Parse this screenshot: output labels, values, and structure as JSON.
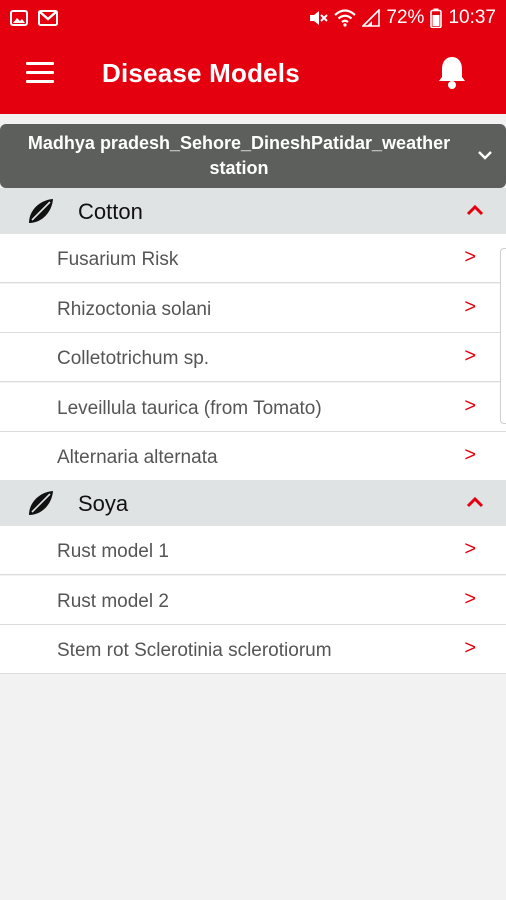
{
  "status_bar": {
    "battery": "72%",
    "time": "10:37",
    "icons": [
      "image-icon",
      "gmail-icon",
      "mute-icon",
      "wifi-icon",
      "signal-icon",
      "battery-icon"
    ]
  },
  "toolbar": {
    "title": "Disease Models",
    "menu_icon": "menu-icon",
    "bell_icon": "bell-icon"
  },
  "station_selector": {
    "value": "Madhya pradesh_Sehore_DineshPatidar_weather station",
    "icon": "chevron-down-icon"
  },
  "groups": [
    {
      "name": "Cotton",
      "icon": "crop-leaf-icon",
      "expanded": true,
      "models": [
        {
          "label": "Fusarium Risk",
          "arrow": ">"
        },
        {
          "label": "Rhizoctonia solani",
          "arrow": ">"
        },
        {
          "label": "Colletotrichum sp.",
          "arrow": ">"
        },
        {
          "label": "Leveillula taurica (from Tomato)",
          "arrow": ">"
        },
        {
          "label": "Alternaria alternata",
          "arrow": ">"
        }
      ]
    },
    {
      "name": "Soya",
      "icon": "crop-leaf-icon",
      "expanded": true,
      "models": [
        {
          "label": "Rust model 1",
          "arrow": ">"
        },
        {
          "label": "Rust model 2",
          "arrow": ">"
        },
        {
          "label": "Stem rot Sclerotinia sclerotiorum",
          "arrow": ">"
        }
      ]
    }
  ],
  "colors": {
    "brand_red": "#e4000f",
    "selector_bg": "#5d5f5d",
    "group_bg": "#dfe3e3",
    "background": "#f2f2f2"
  }
}
